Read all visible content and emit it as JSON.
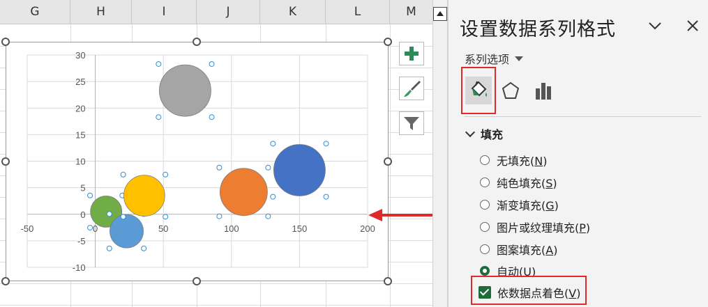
{
  "columns": [
    "G",
    "H",
    "I",
    "J",
    "K",
    "L",
    "M"
  ],
  "chart_data": {
    "type": "scatter",
    "subtype": "bubble",
    "title": "",
    "xlabel": "",
    "ylabel": "",
    "xlim": [
      -50,
      200
    ],
    "ylim": [
      -10,
      30
    ],
    "x_ticks": [
      "-50",
      "0",
      "50",
      "100",
      "150",
      "200"
    ],
    "y_ticks": [
      "30",
      "25",
      "20",
      "15",
      "10",
      "5",
      "0",
      "-5",
      "-10"
    ],
    "grid": true,
    "points": [
      {
        "x": 8,
        "y": 0.5,
        "size": 7,
        "color": "#70ad47"
      },
      {
        "x": 23,
        "y": -3.2,
        "size": 8,
        "color": "#5b9bd5"
      },
      {
        "x": 36,
        "y": 3.5,
        "size": 12,
        "color": "#ffc000"
      },
      {
        "x": 66,
        "y": 23.3,
        "size": 19,
        "color": "#a5a5a5"
      },
      {
        "x": 109,
        "y": 4.2,
        "size": 16,
        "color": "#ed7d31"
      },
      {
        "x": 150,
        "y": 8.3,
        "size": 19,
        "color": "#4472c4"
      }
    ]
  },
  "chart_buttons": [
    "chart-elements",
    "chart-styles",
    "chart-filters"
  ],
  "pane": {
    "title": "设置数据系列格式",
    "series_options": "系列选项",
    "section": "填充",
    "options": [
      {
        "prefix": "无填充(",
        "key": "N",
        "suffix": ")",
        "selected": false
      },
      {
        "prefix": "纯色填充(",
        "key": "S",
        "suffix": ")",
        "selected": false
      },
      {
        "prefix": "渐变填充(",
        "key": "G",
        "suffix": ")",
        "selected": false
      },
      {
        "prefix": "图片或纹理填充(",
        "key": "P",
        "suffix": ")",
        "selected": false
      },
      {
        "prefix": "图案填充(",
        "key": "A",
        "suffix": ")",
        "selected": false
      },
      {
        "prefix": "自动(",
        "key": "U",
        "suffix": ")",
        "selected": true
      }
    ],
    "vary_colors": {
      "prefix": "依数据点着色(",
      "key": "V",
      "suffix": ")",
      "checked": true
    }
  },
  "colors": {
    "highlight": "#e02a2a",
    "check": "#1d6a3b"
  }
}
